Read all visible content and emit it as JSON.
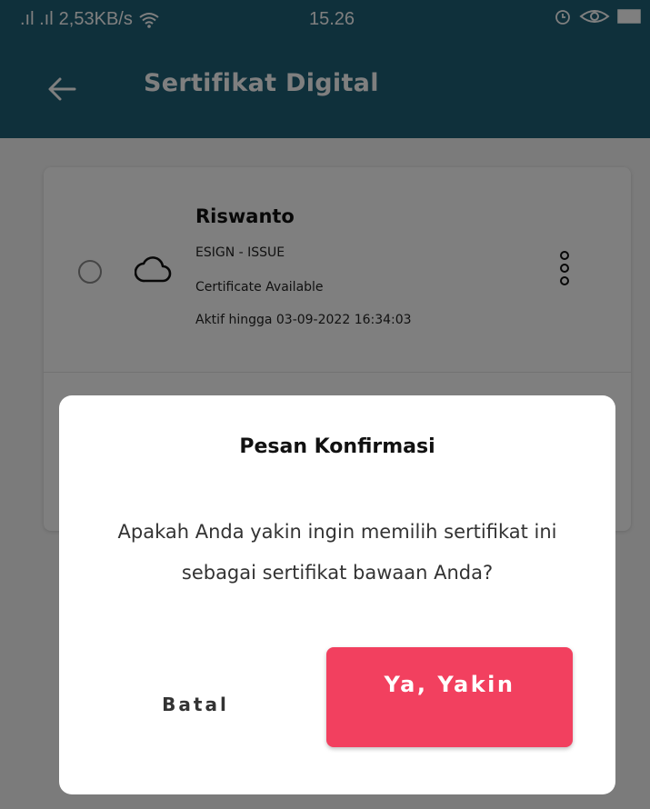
{
  "status_bar": {
    "signal_text": ".ıl .ıl",
    "network_speed": "2,53KB/s",
    "time": "15.26",
    "icons": [
      "wifi-icon",
      "alarm-icon",
      "eye-icon",
      "battery-icon"
    ]
  },
  "app_bar": {
    "title": "Sertifikat Digital",
    "back_icon": "arrow-left-icon",
    "color": "#1f6177"
  },
  "certificates": [
    {
      "name": "Riswanto",
      "type": "ESIGN - ISSUE",
      "status": "Certificate Available",
      "active_until": "Aktif hingga 03-09-2022 16:34:03",
      "icon": "cloud-icon",
      "selected": false
    }
  ],
  "dialog": {
    "title": "Pesan Konfirmasi",
    "message": "Apakah Anda yakin ingin memilih sertifikat ini sebagai sertifikat bawaan Anda?",
    "cancel_label": "Batal",
    "confirm_label": "Ya, Yakin",
    "confirm_color": "#f2405f"
  }
}
